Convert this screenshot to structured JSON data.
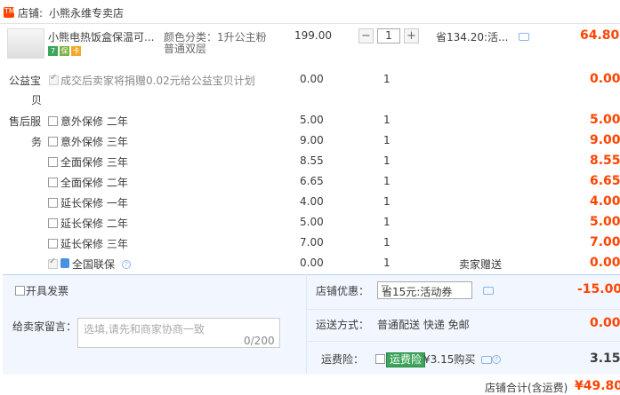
{
  "shop": {
    "prefix": "店铺:",
    "name": "小熊永维专卖店",
    "icon_label": "TM"
  },
  "item": {
    "title": "小熊电热饭盒保温可...",
    "sku_line1": "颜色分类：1升公主粉",
    "sku_line2": "普通双层",
    "unit_price": "199.00",
    "qty": "1",
    "minus": "−",
    "plus": "+",
    "discount": "省134.20:活...",
    "total": "64.80",
    "badges": [
      "7",
      "保",
      "卡"
    ]
  },
  "charity": {
    "label_a": "公益宝",
    "label_b": "贝",
    "text": "成交后卖家将捐赠0.02元给公益宝贝计划",
    "price": "0.00",
    "qty": "1",
    "total": "0.00"
  },
  "service": {
    "label_a": "售后服",
    "label_b": "务",
    "options": [
      {
        "name": "意外保修 二年",
        "price": "5.00",
        "qty": "1",
        "total": "5.00"
      },
      {
        "name": "意外保修 三年",
        "price": "9.00",
        "qty": "1",
        "total": "9.00"
      },
      {
        "name": "全面保修 三年",
        "price": "8.55",
        "qty": "1",
        "total": "8.55"
      },
      {
        "name": "全面保修 二年",
        "price": "6.65",
        "qty": "1",
        "total": "6.65"
      },
      {
        "name": "延长保修 一年",
        "price": "4.00",
        "qty": "1",
        "total": "4.00"
      },
      {
        "name": "延长保修 二年",
        "price": "5.00",
        "qty": "1",
        "total": "5.00"
      },
      {
        "name": "延长保修 三年",
        "price": "7.00",
        "qty": "1",
        "total": "7.00"
      }
    ],
    "joint": {
      "name": "全国联保",
      "price": "0.00",
      "qty": "1",
      "note": "卖家赠送",
      "total": "0.00"
    }
  },
  "invoice": {
    "label": "开具发票"
  },
  "promo": {
    "label": "店铺优惠：",
    "selected": "省15元:活动券",
    "amount": "-15.00"
  },
  "memo": {
    "label": "给卖家留言：",
    "placeholder": "选填,请先和商家协商一致",
    "counter": "0/200"
  },
  "shipping": {
    "label": "运送方式：",
    "method": "普通配送 快递 免邮",
    "amount": "0.00"
  },
  "insurance": {
    "label": "运费险：",
    "tag": "运费险",
    "price": "¥3.15购买",
    "amount": "3.15"
  },
  "summary": {
    "label": "店铺合计(含运费)",
    "total": "¥49.80"
  },
  "colors": {
    "accent": "#ff4400",
    "panel": "#f2f7ff",
    "panel_border": "#b2d1ff",
    "green": "#3ca55c"
  }
}
